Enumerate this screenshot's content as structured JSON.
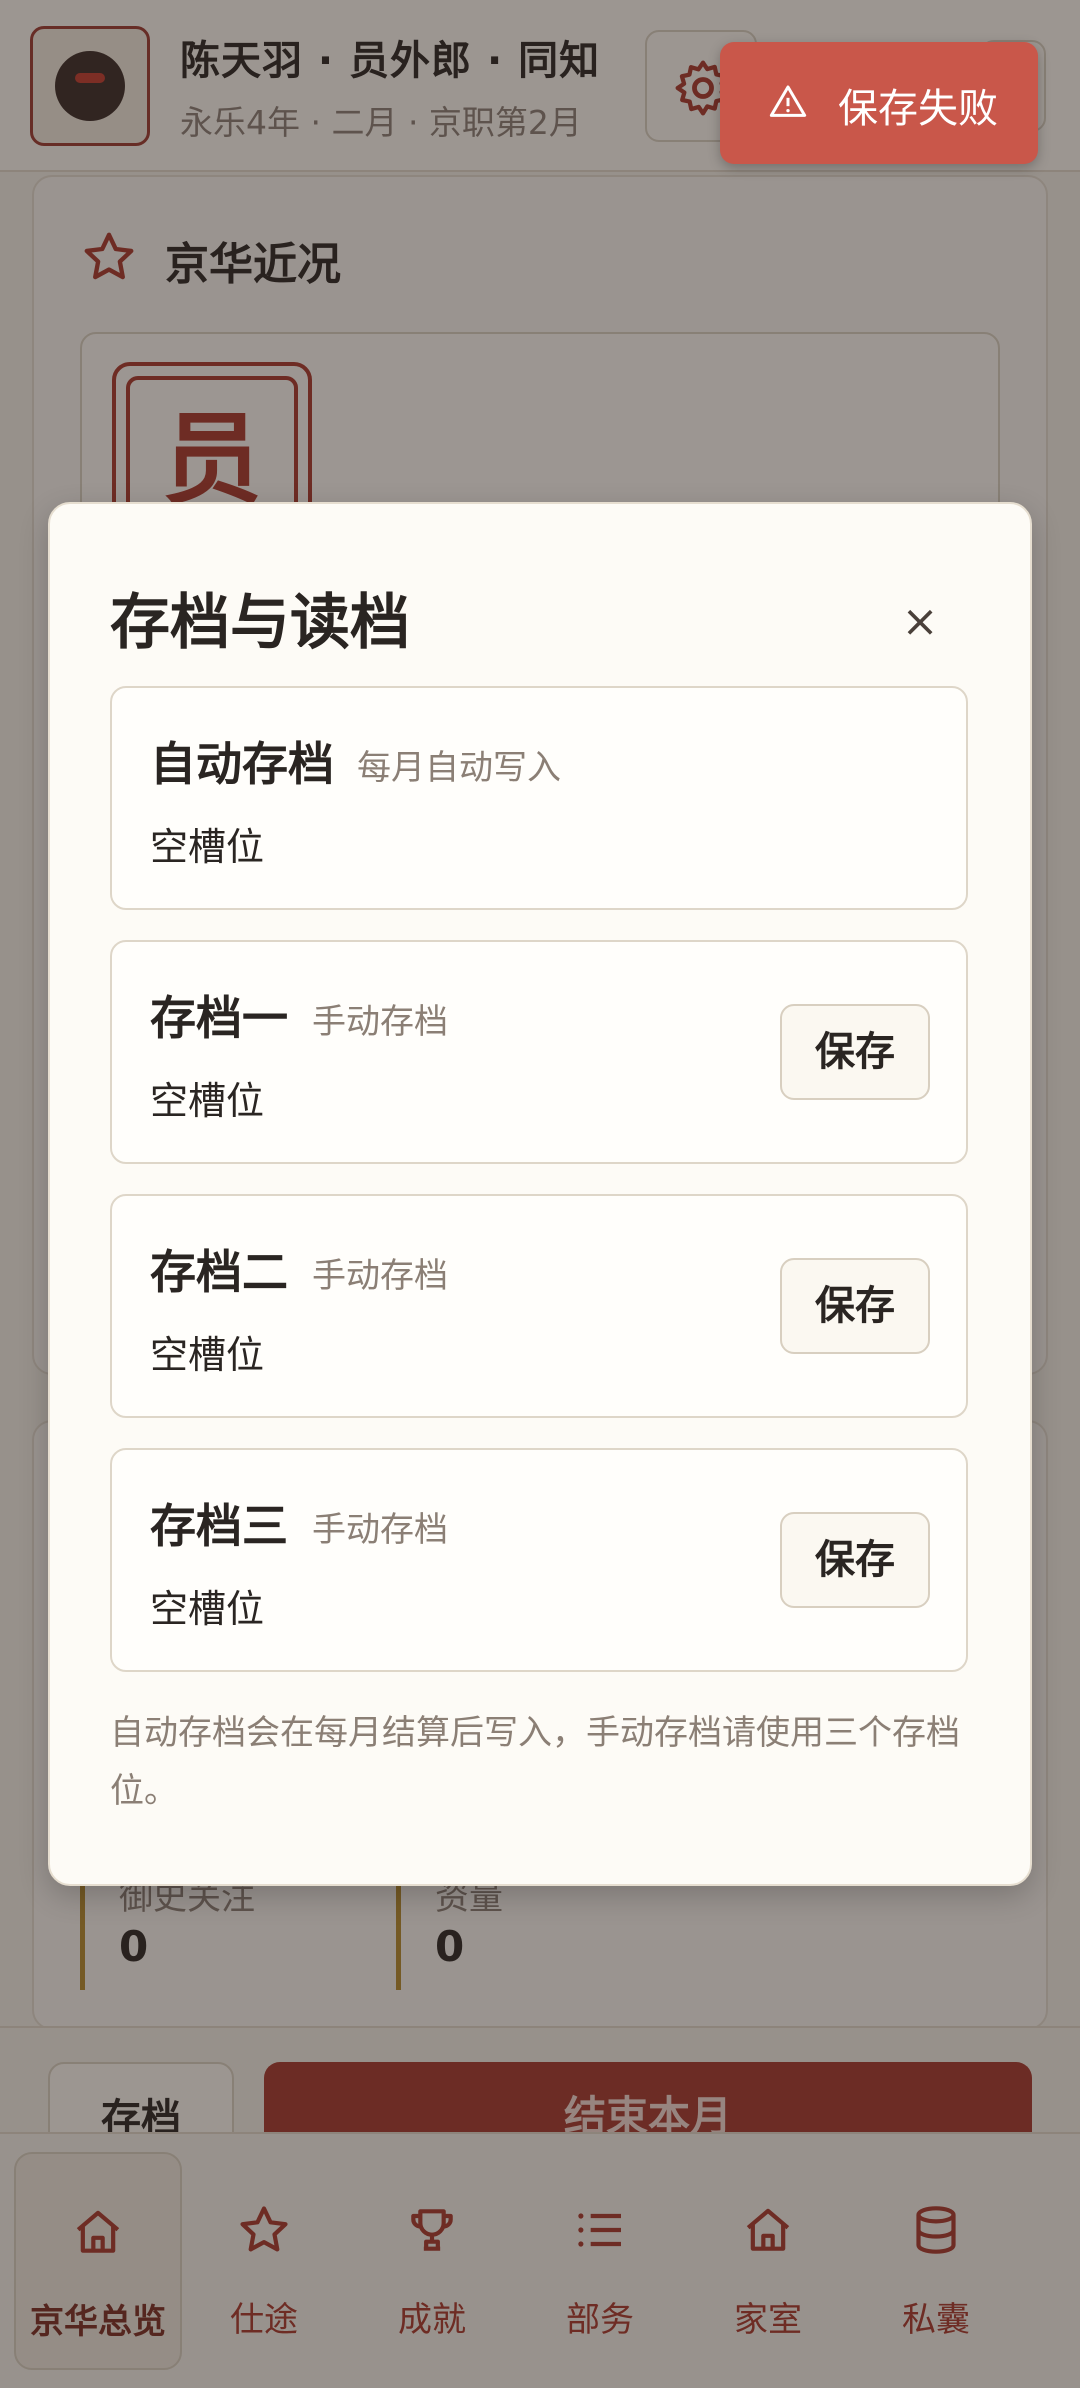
{
  "header": {
    "title": "陈天羽 · 员外郎 · 同知",
    "subtitle": "永乐4年 · 二月 · 京职第2月"
  },
  "background": {
    "section_title": "京华近况",
    "stamp_char": "员",
    "stats": [
      {
        "label": "御史关注",
        "value": "0"
      },
      {
        "label": "资量",
        "value": "0"
      }
    ],
    "save_button": "存档",
    "end_month_button": "结束本月"
  },
  "tabs": [
    {
      "label": "京华总览",
      "icon": "home-icon",
      "active": true
    },
    {
      "label": "仕途",
      "icon": "star-icon",
      "active": false
    },
    {
      "label": "成就",
      "icon": "trophy-icon",
      "active": false
    },
    {
      "label": "部务",
      "icon": "list-icon",
      "active": false
    },
    {
      "label": "家室",
      "icon": "house-icon",
      "active": false
    },
    {
      "label": "私囊",
      "icon": "database-icon",
      "active": false
    }
  ],
  "toast": {
    "text": "保存失败",
    "color": "#c9574a"
  },
  "modal": {
    "title": "存档与读档",
    "close_label": "×",
    "slots": [
      {
        "name": "自动存档",
        "tag": "每月自动写入",
        "status": "空槽位",
        "save_label": ""
      },
      {
        "name": "存档一",
        "tag": "手动存档",
        "status": "空槽位",
        "save_label": "保存"
      },
      {
        "name": "存档二",
        "tag": "手动存档",
        "status": "空槽位",
        "save_label": "保存"
      },
      {
        "name": "存档三",
        "tag": "手动存档",
        "status": "空槽位",
        "save_label": "保存"
      }
    ],
    "note": "自动存档会在每月结算后写入，手动存档请使用三个存档位。"
  },
  "colors": {
    "accent": "#a5382c",
    "background": "#f3efe6",
    "gold": "#b58b2d"
  }
}
